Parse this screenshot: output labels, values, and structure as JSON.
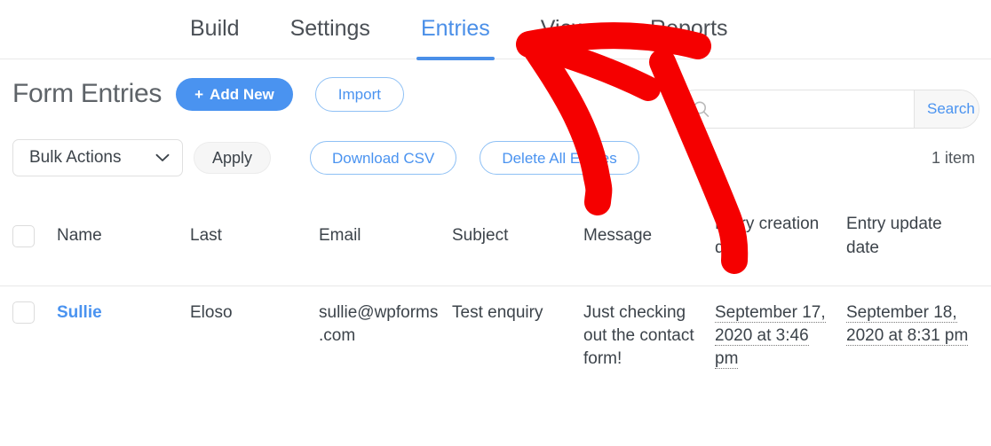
{
  "nav": {
    "tabs": [
      {
        "label": "Build",
        "active": false
      },
      {
        "label": "Settings",
        "active": false
      },
      {
        "label": "Entries",
        "active": true
      },
      {
        "label": "Views",
        "active": false
      },
      {
        "label": "Reports",
        "active": false
      }
    ]
  },
  "header": {
    "title": "Form Entries",
    "add_new_plus": "+",
    "add_new_label": "Add New",
    "import_label": "Import"
  },
  "search": {
    "icon": "search-icon",
    "value": "",
    "placeholder": "",
    "dropdown_label": "Search",
    "dropdown_caret": "⌄"
  },
  "toolbar": {
    "bulk_actions_label": "Bulk Actions",
    "bulk_actions_caret": "⌄",
    "apply_label": "Apply",
    "download_csv_label": "Download CSV",
    "delete_all_label": "Delete All Entries",
    "item_count": "1 item"
  },
  "table": {
    "columns": [
      {
        "key": "check",
        "label": ""
      },
      {
        "key": "name",
        "label": "Name"
      },
      {
        "key": "last",
        "label": "Last"
      },
      {
        "key": "email",
        "label": "Email"
      },
      {
        "key": "subject",
        "label": "Subject"
      },
      {
        "key": "message",
        "label": "Message"
      },
      {
        "key": "created",
        "label": "Entry creation date"
      },
      {
        "key": "updated",
        "label": "Entry update date"
      }
    ],
    "rows": [
      {
        "name": "Sullie",
        "last": "Eloso",
        "email": "sullie@wpforms.com",
        "subject": "Test enquiry",
        "message": "Just checking out the contact form!",
        "created": "September 17, 2020 at 3:46 pm",
        "updated": "September 18, 2020 at 8:31 pm"
      }
    ]
  },
  "colors": {
    "accent_blue": "#4a93f0",
    "annotation_red": "#f50000",
    "text": "#3c434a",
    "border": "#e8e8e8"
  },
  "annotation": {
    "shape": "red-arrow-two-tails",
    "points_to": [
      "Delete All Entries",
      "Entry creation date"
    ]
  }
}
